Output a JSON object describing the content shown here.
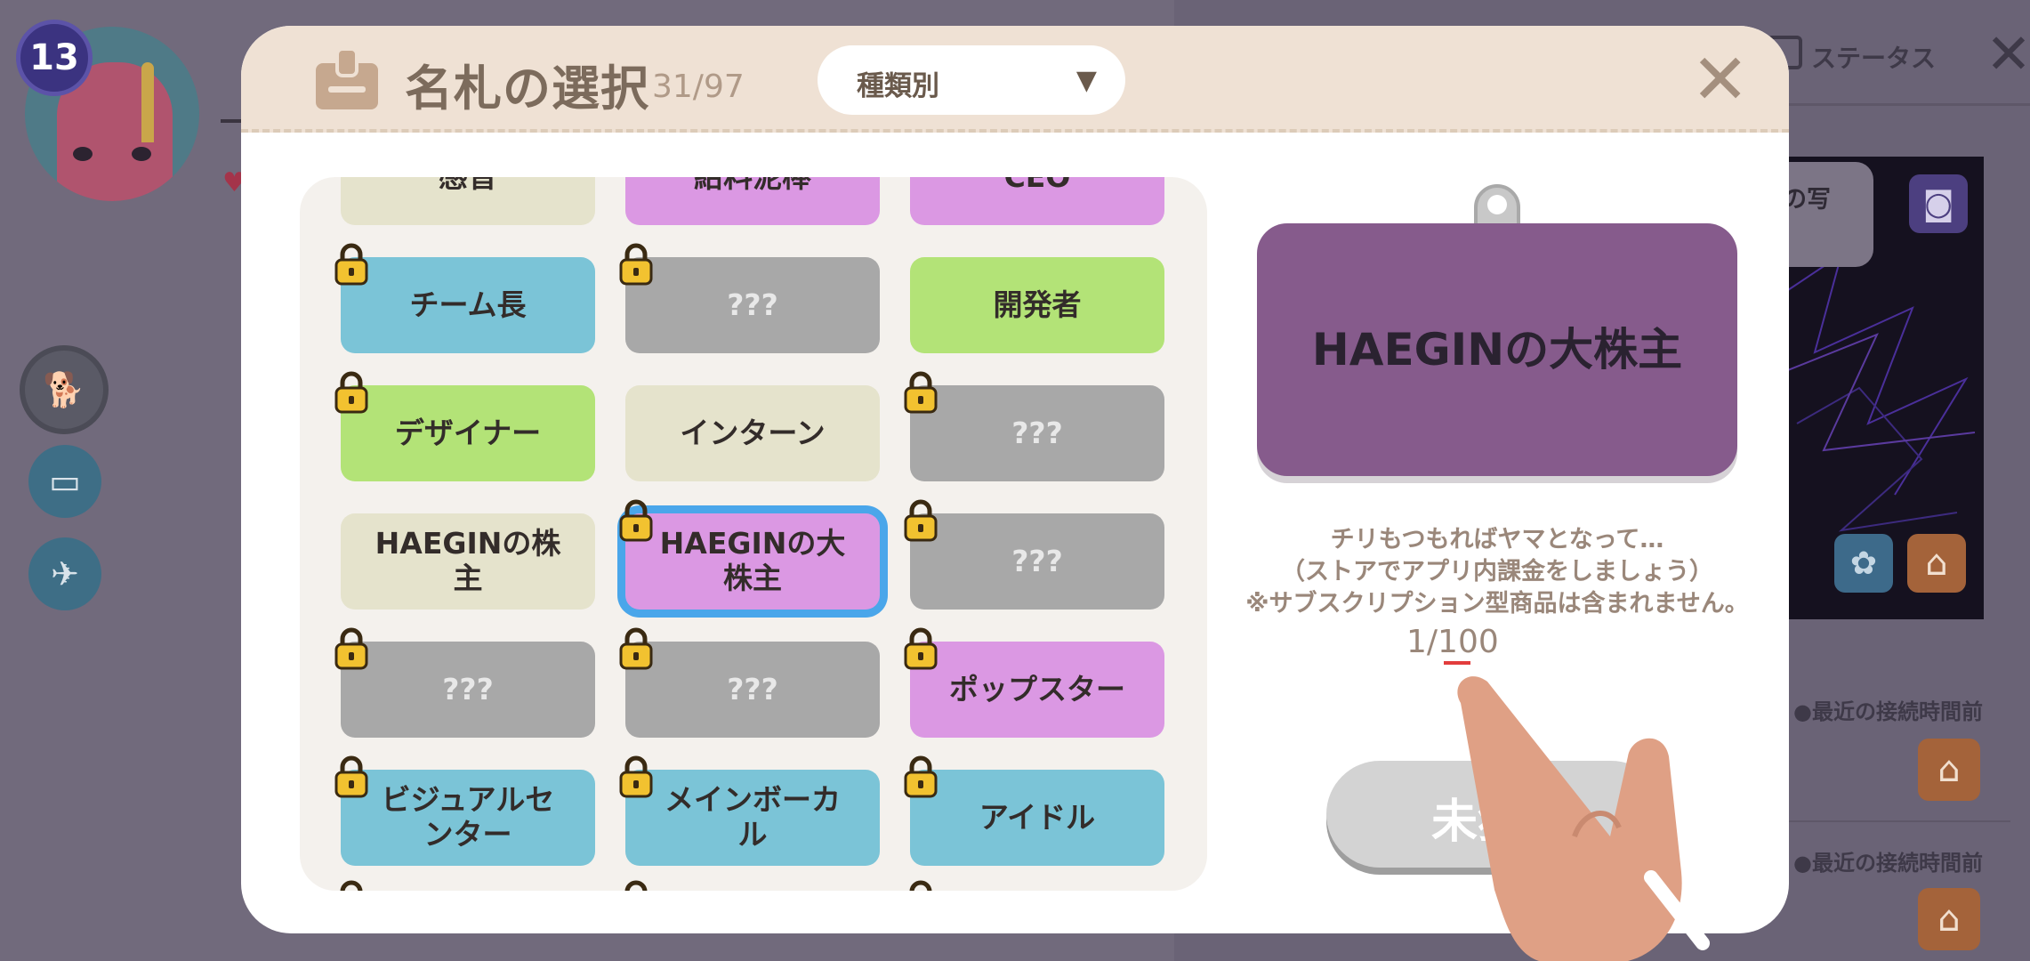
{
  "background": {
    "level": "13",
    "status_label": "ステータス",
    "speech_text": "の写",
    "recent_label_1": "●最近の接続時間前",
    "recent_label_2": "●最近の接続時間前"
  },
  "modal": {
    "title": "名札の選択",
    "count": "31/97",
    "filter": {
      "selected": "種類別"
    },
    "close_icon": "close-icon"
  },
  "tags": [
    {
      "label": "感音",
      "color": "beige",
      "locked": false
    },
    {
      "label": "給料泥棒",
      "color": "purple",
      "locked": false
    },
    {
      "label": "CEO",
      "color": "purple",
      "locked": false
    },
    {
      "label": "チーム長",
      "color": "blue",
      "locked": true
    },
    {
      "label": "???",
      "color": "gray",
      "locked": true
    },
    {
      "label": "開発者",
      "color": "green",
      "locked": false
    },
    {
      "label": "デザイナー",
      "color": "green",
      "locked": true
    },
    {
      "label": "インターン",
      "color": "beige",
      "locked": false
    },
    {
      "label": "???",
      "color": "gray",
      "locked": true
    },
    {
      "label": "HAEGINの株主",
      "color": "beige",
      "locked": false
    },
    {
      "label": "HAEGINの大株主",
      "color": "purple",
      "locked": true,
      "selected": true
    },
    {
      "label": "???",
      "color": "gray",
      "locked": true
    },
    {
      "label": "???",
      "color": "gray",
      "locked": true
    },
    {
      "label": "???",
      "color": "gray",
      "locked": true
    },
    {
      "label": "ポップスター",
      "color": "purple",
      "locked": true
    },
    {
      "label": "ビジュアルセンター",
      "color": "blue",
      "locked": true
    },
    {
      "label": "メインボーカル",
      "color": "blue",
      "locked": true
    },
    {
      "label": "アイドル",
      "color": "blue",
      "locked": true
    }
  ],
  "preview": {
    "label": "HAEGINの大株主",
    "description_1": "チリもつもればヤマとなって…",
    "description_2": "（ストアでアプリ内課金をしましょう）",
    "description_3": "※サブスクリプション型商品は含まれません。",
    "progress_text": "1/100",
    "progress": 0.01,
    "button_label": "未獲得"
  },
  "colors": {
    "blue": "#7bc4d7",
    "green": "#b3e377",
    "beige": "#e5e3cc",
    "purple": "#db98e3",
    "gray": "#a8a8a8",
    "selected_border": "#4aa6ea",
    "preview_card": "#865b8c"
  }
}
